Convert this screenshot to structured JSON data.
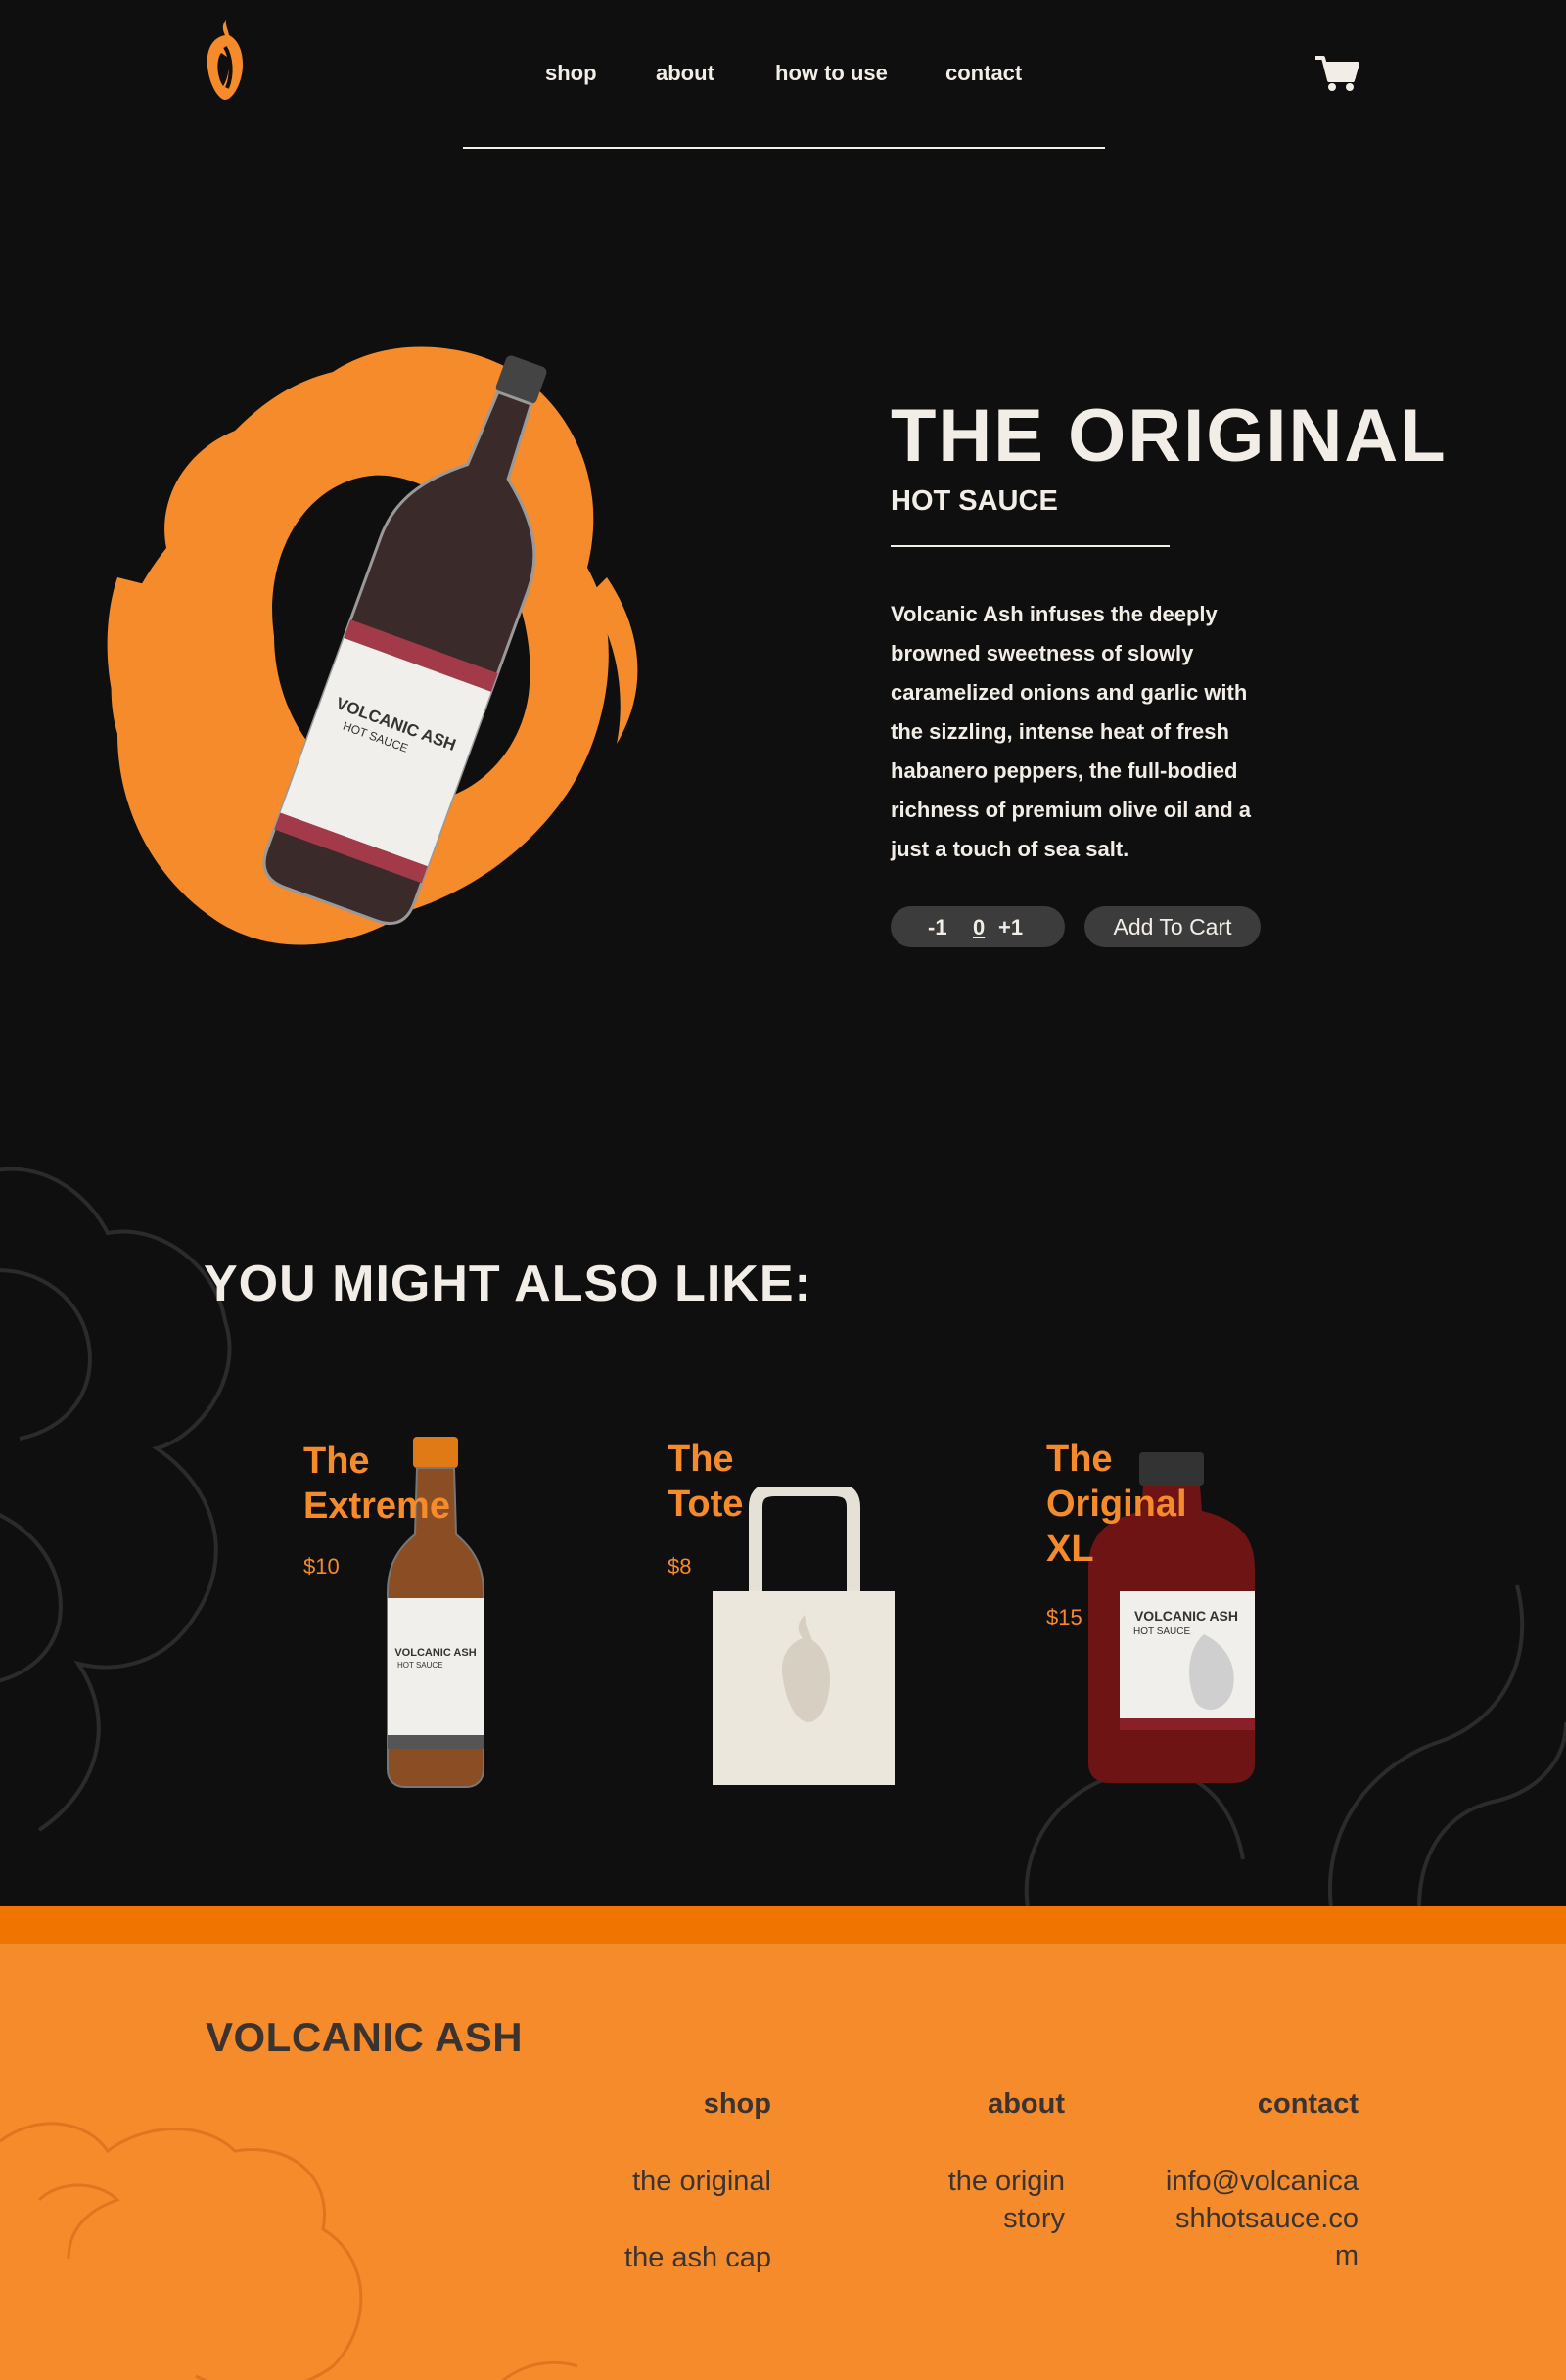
{
  "brand": {
    "name": "VOLCANIC ASH",
    "logo_icon": "pepper-logo-icon",
    "accent": "#f58b2b",
    "accent_dark": "#f07400",
    "background": "#0f0f0f"
  },
  "nav": {
    "items": [
      {
        "label": "shop"
      },
      {
        "label": "about"
      },
      {
        "label": "how to use"
      },
      {
        "label": "contact"
      }
    ],
    "cart_icon": "cart-icon"
  },
  "product": {
    "title": "THE ORIGINAL",
    "subtitle": "HOT SAUCE",
    "description": "Volcanic Ash infuses the deeply browned sweetness of slowly caramelized onions and garlic with the sizzling, intense heat of fresh habanero peppers, the full-bodied richness of premium olive oil and a just a touch of sea salt.",
    "quantity": {
      "decrement_label": "-1",
      "value": "0",
      "increment_label": "+1"
    },
    "add_to_cart_label": "Add To Cart",
    "bottle_label": {
      "brand": "VOLCANIC ASH",
      "type": "HOT SAUCE"
    }
  },
  "related": {
    "heading": "YOU MIGHT ALSO LIKE:",
    "items": [
      {
        "title_line1": "The",
        "title_line2": "Extreme",
        "price": "$10",
        "label_brand": "VOLCANIC ASH",
        "label_type": "HOT SAUCE"
      },
      {
        "title_line1": "The",
        "title_line2": "Tote",
        "price": "$8"
      },
      {
        "title_line1": "The",
        "title_line2": "Original",
        "title_line3": "XL",
        "price": "$15",
        "label_brand": "VOLCANIC ASH",
        "label_type": "HOT SAUCE"
      }
    ]
  },
  "footer": {
    "brand": "VOLCANIC ASH",
    "columns": [
      {
        "heading": "shop",
        "links": [
          "the original",
          "the ash cap"
        ]
      },
      {
        "heading": "about",
        "links": [
          "the origin story"
        ]
      },
      {
        "heading": "contact",
        "links": [
          "info@volcanicashhotsauce.com"
        ]
      }
    ]
  }
}
